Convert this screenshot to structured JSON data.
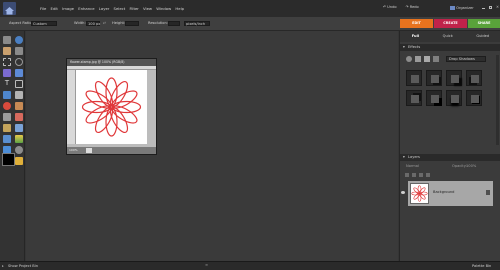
{
  "menu": [
    "File",
    "Edit",
    "Image",
    "Enhance",
    "Layer",
    "Select",
    "Filter",
    "View",
    "Window",
    "Help"
  ],
  "topbar": {
    "undo": "Undo",
    "redo": "Redo",
    "organizer": "Organizer"
  },
  "options": {
    "aspect_label": "Aspect Ratio:",
    "aspect_value": "Custom",
    "width_label": "Width:",
    "width_value": "100 px",
    "height_label": "Height:",
    "resolution_label": "Resolution:",
    "resolution_unit": "pixels/inch"
  },
  "modes": {
    "edit": "EDIT",
    "create": "CREATE",
    "share": "SHARE"
  },
  "mode_colors": {
    "edit": "#e8731e",
    "create": "#c0234a",
    "share": "#59a23a"
  },
  "view_tabs": {
    "full": "Full",
    "quick": "Quick",
    "guided": "Guided"
  },
  "document": {
    "title": "flower-stamp.jpg @ 100% (RGB/8)",
    "zoom": "100%"
  },
  "effects": {
    "header": "Effects",
    "dropdown": "Drop Shadows"
  },
  "layers": {
    "header": "Layers",
    "blend": "Normal",
    "opacity_label": "Opacity:",
    "opacity_value": "100%",
    "layer_name": "Background"
  },
  "statusbar": {
    "project_bin": "Show Project Bin",
    "palette_bin": "Palette Bin"
  },
  "icons": [
    "logo-icon",
    "undo-icon",
    "redo-icon",
    "organizer-icon",
    "move-tool-icon",
    "zoom-tool-icon",
    "hand-tool-icon",
    "eyedropper-tool-icon",
    "marquee-tool-icon",
    "lasso-tool-icon",
    "magic-wand-icon",
    "selection-brush-icon",
    "text-tool-icon",
    "crop-tool-icon",
    "cookie-cutter-icon",
    "straighten-icon",
    "redeye-icon",
    "spot-healing-icon",
    "clone-stamp-icon",
    "eraser-icon",
    "brush-icon",
    "smart-brush-icon",
    "paint-bucket-icon",
    "gradient-icon",
    "shape-icon",
    "blur-icon",
    "sponge-icon",
    "pencil-icon",
    "foreground-color-icon",
    "background-color-icon",
    "eye-icon",
    "lock-icon",
    "trash-icon"
  ],
  "accent": {
    "flower": "#e0383a",
    "selected_layer": "#a7a7a7"
  }
}
